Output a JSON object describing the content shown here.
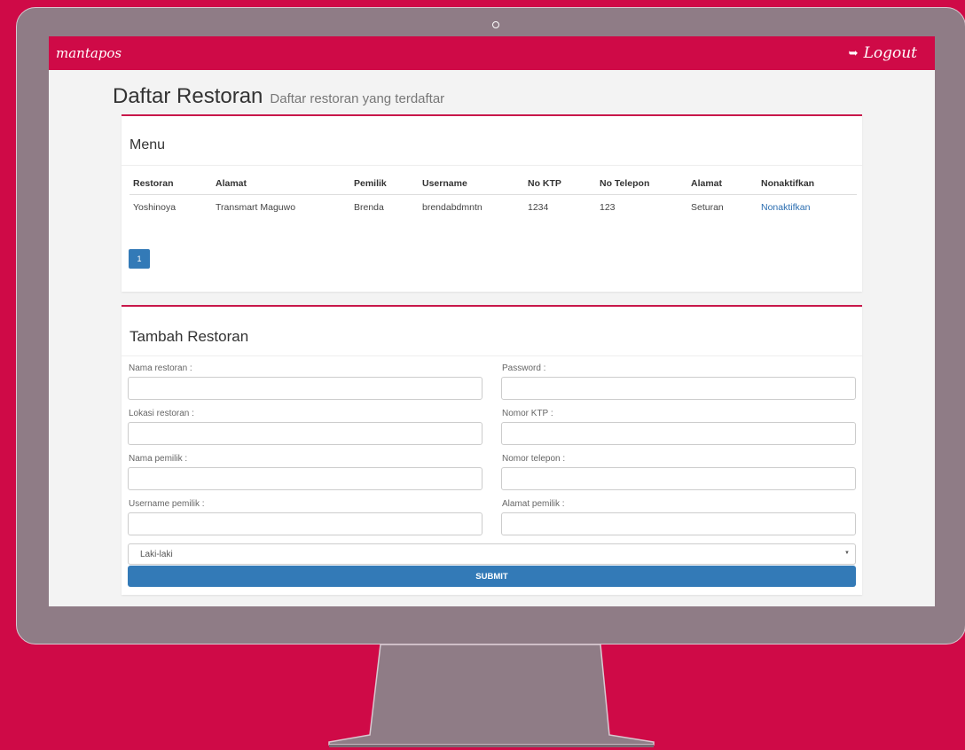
{
  "navbar": {
    "brand": "mantapos",
    "logout_label": "Logout",
    "logout_icon": "sign-out-icon"
  },
  "header": {
    "title": "Daftar Restoran",
    "subtitle": "Daftar restoran yang terdaftar"
  },
  "menu_panel": {
    "title": "Menu",
    "columns": [
      "Restoran",
      "Alamat",
      "Pemilik",
      "Username",
      "No KTP",
      "No Telepon",
      "Alamat",
      "Nonaktifkan"
    ],
    "rows": [
      [
        "Yoshinoya",
        "Transmart Maguwo",
        "Brenda",
        "brendabdmntn",
        "1234",
        "123",
        "Seturan",
        "Nonaktifkan"
      ]
    ],
    "pagination": {
      "current_page": "1"
    }
  },
  "add_panel": {
    "title": "Tambah Restoran",
    "fields": {
      "nama_restoran": {
        "label": "Nama restoran :",
        "value": ""
      },
      "password": {
        "label": "Password :",
        "value": ""
      },
      "lokasi_restoran": {
        "label": "Lokasi restoran :",
        "value": ""
      },
      "nomor_ktp": {
        "label": "Nomor KTP :",
        "value": ""
      },
      "nama_pemilik": {
        "label": "Nama pemilik :",
        "value": ""
      },
      "nomor_telepon": {
        "label": "Nomor telepon :",
        "value": ""
      },
      "username_pemilik": {
        "label": "Username pemilik :",
        "value": ""
      },
      "alamat_pemilik": {
        "label": "Alamat pemilik :",
        "value": ""
      }
    },
    "gender_select": {
      "selected": "Laki-laki"
    },
    "submit_label": "SUBMIT"
  },
  "colors": {
    "brand": "#cf0a47",
    "primary": "#337ab7",
    "bezel": "#8f7c86",
    "link": "#2a6db0"
  }
}
